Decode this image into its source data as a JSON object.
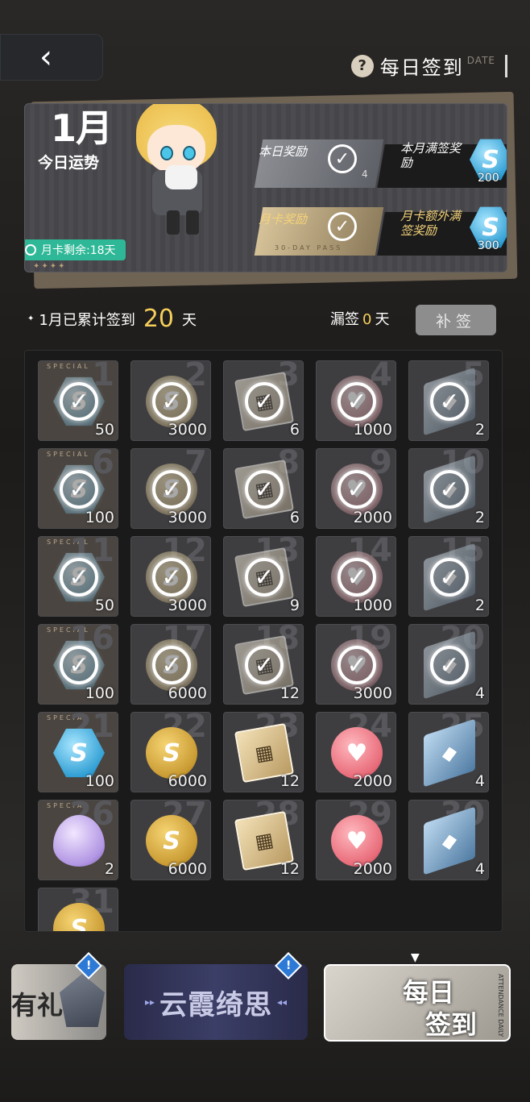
{
  "header": {
    "back_label": "‹",
    "title": "每日签到",
    "date_tag": "DATE",
    "help": "?"
  },
  "banner": {
    "month": "1月",
    "fortune": "今日运势",
    "month_card": "月卡剩余:18天",
    "stars": "✦✦✦✦",
    "today_reward": "本日奖励",
    "today_count": "4",
    "month_full": "本月满签奖励",
    "month_full_count": "200",
    "card_reward": "月卡奖励",
    "card_extra": "月卡额外满签奖励",
    "card_extra_count": "300",
    "pass_text": "30-DAY PASS"
  },
  "stats": {
    "prefix": "1月已累计签到",
    "days": "20",
    "suffix": "天",
    "miss_prefix": "漏签",
    "miss": "0",
    "miss_suffix": "天",
    "makeup": "补签"
  },
  "grid": [
    {
      "day": "1",
      "qty": "50",
      "type": "gem",
      "special": true,
      "checked": true
    },
    {
      "day": "2",
      "qty": "3000",
      "type": "coin",
      "special": false,
      "checked": true
    },
    {
      "day": "3",
      "qty": "6",
      "type": "chip",
      "special": false,
      "checked": true
    },
    {
      "day": "4",
      "qty": "1000",
      "type": "heart",
      "special": false,
      "checked": true
    },
    {
      "day": "5",
      "qty": "2",
      "type": "plat",
      "special": false,
      "checked": true
    },
    {
      "day": "6",
      "qty": "100",
      "type": "gem",
      "special": true,
      "checked": true
    },
    {
      "day": "7",
      "qty": "3000",
      "type": "coin",
      "special": false,
      "checked": true
    },
    {
      "day": "8",
      "qty": "6",
      "type": "chip",
      "special": false,
      "checked": true
    },
    {
      "day": "9",
      "qty": "2000",
      "type": "heart",
      "special": false,
      "checked": true
    },
    {
      "day": "10",
      "qty": "2",
      "type": "plat",
      "special": false,
      "checked": true
    },
    {
      "day": "11",
      "qty": "50",
      "type": "gem",
      "special": true,
      "checked": true
    },
    {
      "day": "12",
      "qty": "3000",
      "type": "coin",
      "special": false,
      "checked": true
    },
    {
      "day": "13",
      "qty": "9",
      "type": "chip",
      "special": false,
      "checked": true
    },
    {
      "day": "14",
      "qty": "1000",
      "type": "heart",
      "special": false,
      "checked": true
    },
    {
      "day": "15",
      "qty": "2",
      "type": "plat",
      "special": false,
      "checked": true
    },
    {
      "day": "16",
      "qty": "100",
      "type": "gem",
      "special": true,
      "checked": true
    },
    {
      "day": "17",
      "qty": "6000",
      "type": "coin",
      "special": false,
      "checked": true
    },
    {
      "day": "18",
      "qty": "12",
      "type": "chip",
      "special": false,
      "checked": true
    },
    {
      "day": "19",
      "qty": "3000",
      "type": "heart",
      "special": false,
      "checked": true
    },
    {
      "day": "20",
      "qty": "4",
      "type": "plat",
      "special": false,
      "checked": true
    },
    {
      "day": "21",
      "qty": "100",
      "type": "gem",
      "special": true,
      "checked": false
    },
    {
      "day": "22",
      "qty": "6000",
      "type": "coin",
      "special": false,
      "checked": false
    },
    {
      "day": "23",
      "qty": "12",
      "type": "chip",
      "special": false,
      "checked": false
    },
    {
      "day": "24",
      "qty": "2000",
      "type": "heart",
      "special": false,
      "checked": false
    },
    {
      "day": "25",
      "qty": "4",
      "type": "plat",
      "special": false,
      "checked": false
    },
    {
      "day": "26",
      "qty": "2",
      "type": "crystal",
      "special": true,
      "checked": false
    },
    {
      "day": "27",
      "qty": "6000",
      "type": "coin",
      "special": false,
      "checked": false
    },
    {
      "day": "28",
      "qty": "12",
      "type": "chip",
      "special": false,
      "checked": false
    },
    {
      "day": "29",
      "qty": "2000",
      "type": "heart",
      "special": false,
      "checked": false
    },
    {
      "day": "30",
      "qty": "4",
      "type": "plat",
      "special": false,
      "checked": false
    },
    {
      "day": "31",
      "qty": "",
      "type": "coin",
      "special": false,
      "checked": false
    }
  ],
  "special_label": "SPECIAL",
  "tabs": {
    "gift": "有礼",
    "event": "云霞绮思",
    "daily_l1": "每日",
    "daily_l2": "签到",
    "daily_side": "ATTENDANCE DAILY",
    "badge": "!"
  },
  "colors": {
    "accent_yellow": "#f5cf5a",
    "teal": "#2fb897"
  }
}
